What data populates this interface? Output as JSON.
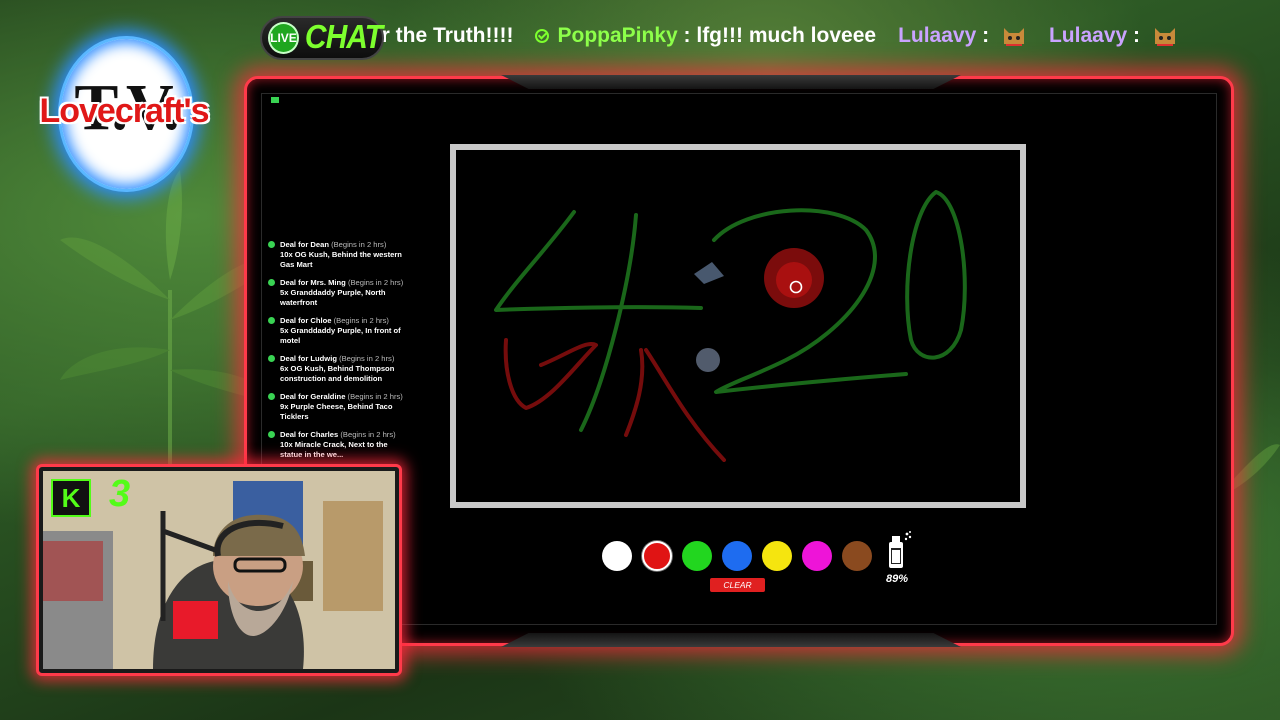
{
  "chat": {
    "badge_live": "LIVE",
    "badge_label": "CHAT",
    "messages": [
      {
        "user": "",
        "text": "ar the Truth!!!!"
      },
      {
        "user": "PoppaPinky",
        "text": ": lfg!!! much loveee"
      },
      {
        "user": "Lulaavy",
        "text": ":",
        "emote": "cat-emote-icon"
      },
      {
        "user": "Lulaavy",
        "text": ":",
        "emote": "cat-emote-icon"
      }
    ]
  },
  "logo": {
    "name": "Lovecraft's",
    "tv": "T.V."
  },
  "deals": [
    {
      "title": "Deal for Dean",
      "time": "(Begins in 2 hrs)",
      "body": "10x OG Kush, Behind the western Gas Mart"
    },
    {
      "title": "Deal for Mrs. Ming",
      "time": "(Begins in 2 hrs)",
      "body": "5x Granddaddy Purple, North waterfront"
    },
    {
      "title": "Deal for Chloe",
      "time": "(Begins in 2 hrs)",
      "body": "5x Granddaddy Purple, In front of motel"
    },
    {
      "title": "Deal for Ludwig",
      "time": "(Begins in 2 hrs)",
      "body": "6x OG Kush, Behind Thompson construction and demolition"
    },
    {
      "title": "Deal for Geraldine",
      "time": "(Begins in 2 hrs)",
      "body": "9x Purple Cheese, Behind Taco Ticklers"
    },
    {
      "title": "Deal for Charles",
      "time": "(Begins in 2 hrs)",
      "body": "10x Miracle Crack, Next to the statue in the we..."
    }
  ],
  "palette": {
    "colors": [
      "#ffffff",
      "#e01414",
      "#22d61f",
      "#1e6cf0",
      "#f5e50f",
      "#ee14d8",
      "#8a4a1f"
    ],
    "selected_index": 1,
    "clear_label": "CLEAR",
    "spray_level": "89%",
    "spray_icon": "spray-can-icon"
  },
  "webcam": {
    "platform_icon": "kick-icon",
    "platform_letter": "K",
    "viewer_count": "3"
  },
  "colors": {
    "frame_glow": "#ff3a4a",
    "chat_green": "#7dff2e",
    "username_purple": "#c9a3ff",
    "kick_green": "#53fc18"
  }
}
